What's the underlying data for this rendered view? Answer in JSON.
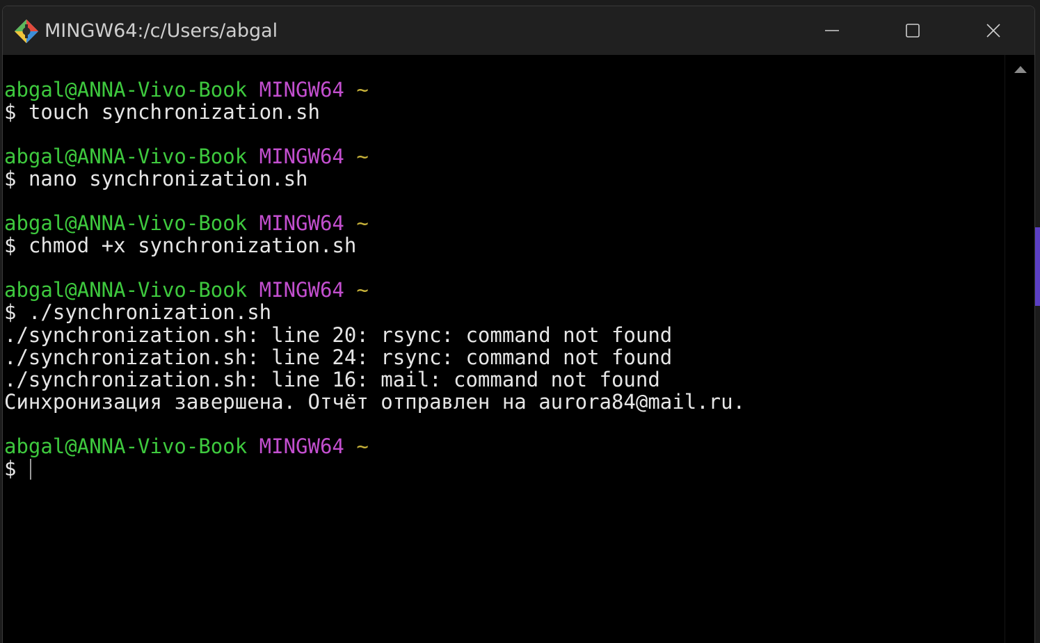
{
  "window": {
    "title": "MINGW64:/c/Users/abgal",
    "icon": "git-bash-icon",
    "controls": {
      "minimize": "minimize-icon",
      "maximize": "maximize-icon",
      "close": "close-icon"
    }
  },
  "terminal": {
    "colors": {
      "user_host": "#3ec93e",
      "system": "#c34fcf",
      "path": "#c9b33a",
      "text": "#e6e6e6"
    },
    "prompt": {
      "user_host": "abgal@ANNA-Vivo-Book",
      "system": "MINGW64",
      "path": "~",
      "symbol": "$"
    },
    "blocks": [
      {
        "command": "touch synchronization.sh",
        "output": []
      },
      {
        "command": "nano synchronization.sh",
        "output": []
      },
      {
        "command": "chmod +x synchronization.sh",
        "output": []
      },
      {
        "command": "./synchronization.sh",
        "output": [
          "./synchronization.sh: line 20: rsync: command not found",
          "./synchronization.sh: line 24: rsync: command not found",
          "./synchronization.sh: line 16: mail: command not found",
          "Синхронизация завершена. Отчёт отправлен на aurora84@mail.ru."
        ]
      },
      {
        "command": "",
        "output": []
      }
    ]
  }
}
